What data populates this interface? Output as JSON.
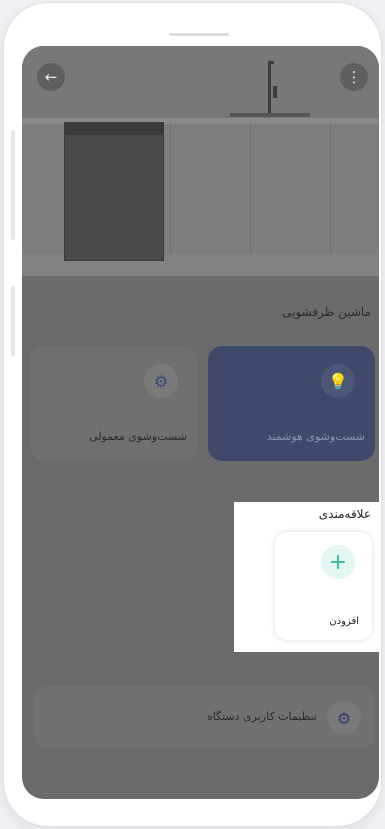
{
  "header": {
    "back_icon": "arrow-left-icon",
    "back_glyph": "←",
    "menu_icon": "more-vertical-icon",
    "menu_glyph": "⋮"
  },
  "device": {
    "title": "ماشین ظرفشویی"
  },
  "modes": [
    {
      "label": "شست‌وشوی هوشمند",
      "icon": "lightbulb-sparkle-icon",
      "glyph": "💡",
      "active": true
    },
    {
      "label": "شست‌وشوی معمولی",
      "icon": "washer-icon",
      "glyph": "⚙",
      "active": false
    }
  ],
  "favorites": {
    "title": "علاقه‌مندی",
    "add_label": "افزودن",
    "add_glyph": "+"
  },
  "settings": {
    "label": "تنظیمات کاربری دستگاه",
    "icon": "gear-icon",
    "glyph": "⚙"
  },
  "colors": {
    "accent_active": "#3f4a6b",
    "add_accent": "#2fbfa0",
    "overlay": "#6b6b6b"
  }
}
